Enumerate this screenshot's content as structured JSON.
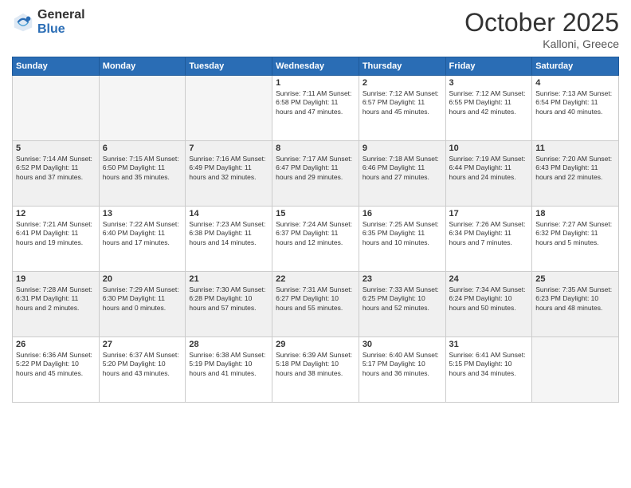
{
  "logo": {
    "general": "General",
    "blue": "Blue"
  },
  "header": {
    "month": "October 2025",
    "location": "Kalloni, Greece"
  },
  "weekdays": [
    "Sunday",
    "Monday",
    "Tuesday",
    "Wednesday",
    "Thursday",
    "Friday",
    "Saturday"
  ],
  "weeks": [
    [
      {
        "day": "",
        "info": ""
      },
      {
        "day": "",
        "info": ""
      },
      {
        "day": "",
        "info": ""
      },
      {
        "day": "1",
        "info": "Sunrise: 7:11 AM\nSunset: 6:58 PM\nDaylight: 11 hours and 47 minutes."
      },
      {
        "day": "2",
        "info": "Sunrise: 7:12 AM\nSunset: 6:57 PM\nDaylight: 11 hours and 45 minutes."
      },
      {
        "day": "3",
        "info": "Sunrise: 7:12 AM\nSunset: 6:55 PM\nDaylight: 11 hours and 42 minutes."
      },
      {
        "day": "4",
        "info": "Sunrise: 7:13 AM\nSunset: 6:54 PM\nDaylight: 11 hours and 40 minutes."
      }
    ],
    [
      {
        "day": "5",
        "info": "Sunrise: 7:14 AM\nSunset: 6:52 PM\nDaylight: 11 hours and 37 minutes."
      },
      {
        "day": "6",
        "info": "Sunrise: 7:15 AM\nSunset: 6:50 PM\nDaylight: 11 hours and 35 minutes."
      },
      {
        "day": "7",
        "info": "Sunrise: 7:16 AM\nSunset: 6:49 PM\nDaylight: 11 hours and 32 minutes."
      },
      {
        "day": "8",
        "info": "Sunrise: 7:17 AM\nSunset: 6:47 PM\nDaylight: 11 hours and 29 minutes."
      },
      {
        "day": "9",
        "info": "Sunrise: 7:18 AM\nSunset: 6:46 PM\nDaylight: 11 hours and 27 minutes."
      },
      {
        "day": "10",
        "info": "Sunrise: 7:19 AM\nSunset: 6:44 PM\nDaylight: 11 hours and 24 minutes."
      },
      {
        "day": "11",
        "info": "Sunrise: 7:20 AM\nSunset: 6:43 PM\nDaylight: 11 hours and 22 minutes."
      }
    ],
    [
      {
        "day": "12",
        "info": "Sunrise: 7:21 AM\nSunset: 6:41 PM\nDaylight: 11 hours and 19 minutes."
      },
      {
        "day": "13",
        "info": "Sunrise: 7:22 AM\nSunset: 6:40 PM\nDaylight: 11 hours and 17 minutes."
      },
      {
        "day": "14",
        "info": "Sunrise: 7:23 AM\nSunset: 6:38 PM\nDaylight: 11 hours and 14 minutes."
      },
      {
        "day": "15",
        "info": "Sunrise: 7:24 AM\nSunset: 6:37 PM\nDaylight: 11 hours and 12 minutes."
      },
      {
        "day": "16",
        "info": "Sunrise: 7:25 AM\nSunset: 6:35 PM\nDaylight: 11 hours and 10 minutes."
      },
      {
        "day": "17",
        "info": "Sunrise: 7:26 AM\nSunset: 6:34 PM\nDaylight: 11 hours and 7 minutes."
      },
      {
        "day": "18",
        "info": "Sunrise: 7:27 AM\nSunset: 6:32 PM\nDaylight: 11 hours and 5 minutes."
      }
    ],
    [
      {
        "day": "19",
        "info": "Sunrise: 7:28 AM\nSunset: 6:31 PM\nDaylight: 11 hours and 2 minutes."
      },
      {
        "day": "20",
        "info": "Sunrise: 7:29 AM\nSunset: 6:30 PM\nDaylight: 11 hours and 0 minutes."
      },
      {
        "day": "21",
        "info": "Sunrise: 7:30 AM\nSunset: 6:28 PM\nDaylight: 10 hours and 57 minutes."
      },
      {
        "day": "22",
        "info": "Sunrise: 7:31 AM\nSunset: 6:27 PM\nDaylight: 10 hours and 55 minutes."
      },
      {
        "day": "23",
        "info": "Sunrise: 7:33 AM\nSunset: 6:25 PM\nDaylight: 10 hours and 52 minutes."
      },
      {
        "day": "24",
        "info": "Sunrise: 7:34 AM\nSunset: 6:24 PM\nDaylight: 10 hours and 50 minutes."
      },
      {
        "day": "25",
        "info": "Sunrise: 7:35 AM\nSunset: 6:23 PM\nDaylight: 10 hours and 48 minutes."
      }
    ],
    [
      {
        "day": "26",
        "info": "Sunrise: 6:36 AM\nSunset: 5:22 PM\nDaylight: 10 hours and 45 minutes."
      },
      {
        "day": "27",
        "info": "Sunrise: 6:37 AM\nSunset: 5:20 PM\nDaylight: 10 hours and 43 minutes."
      },
      {
        "day": "28",
        "info": "Sunrise: 6:38 AM\nSunset: 5:19 PM\nDaylight: 10 hours and 41 minutes."
      },
      {
        "day": "29",
        "info": "Sunrise: 6:39 AM\nSunset: 5:18 PM\nDaylight: 10 hours and 38 minutes."
      },
      {
        "day": "30",
        "info": "Sunrise: 6:40 AM\nSunset: 5:17 PM\nDaylight: 10 hours and 36 minutes."
      },
      {
        "day": "31",
        "info": "Sunrise: 6:41 AM\nSunset: 5:15 PM\nDaylight: 10 hours and 34 minutes."
      },
      {
        "day": "",
        "info": ""
      }
    ]
  ]
}
